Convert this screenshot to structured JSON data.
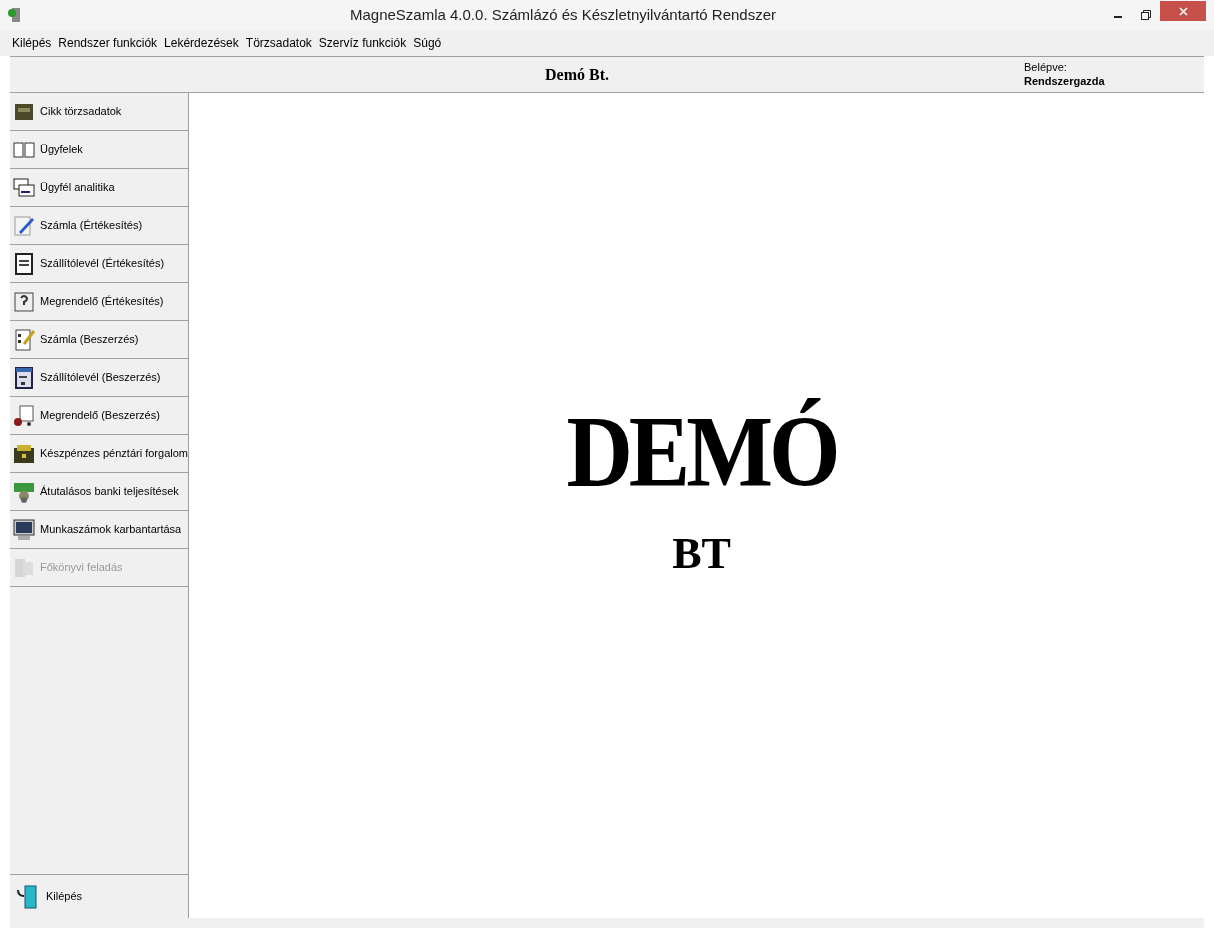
{
  "window": {
    "title": "MagneSzamla 4.0.0. Számlázó és Készletnyilvántartó Rendszer"
  },
  "menu": [
    "Kilépés",
    "Rendszer funkciók",
    "Lekérdezések",
    "Törzsadatok",
    "Szervíz funkciók",
    "Súgó"
  ],
  "header": {
    "company": "Demó Bt.",
    "login_label": "Belépve:",
    "user": "Rendszergazda"
  },
  "sidebar": {
    "items": [
      {
        "label": "Cikk törzsadatok",
        "disabled": false
      },
      {
        "label": "Ügyfelek",
        "disabled": false
      },
      {
        "label": "Ügyfél analitika",
        "disabled": false
      },
      {
        "label": "Számla (Értékesítés)",
        "disabled": false
      },
      {
        "label": "Szállítólevél (Értékesítés)",
        "disabled": false
      },
      {
        "label": "Megrendelő (Értékesítés)",
        "disabled": false
      },
      {
        "label": "Számla (Beszerzés)",
        "disabled": false
      },
      {
        "label": "Szállítólevél (Beszerzés)",
        "disabled": false
      },
      {
        "label": "Megrendelő (Beszerzés)",
        "disabled": false
      },
      {
        "label": "Készpénzes pénztári forgalom",
        "disabled": false
      },
      {
        "label": "Átutalásos banki teljesítések",
        "disabled": false
      },
      {
        "label": "Munkaszámok karbantartása",
        "disabled": false
      },
      {
        "label": "Főkönyvi feladás",
        "disabled": true
      }
    ],
    "exit": "Kilépés"
  },
  "logo": {
    "title": "DEMÓ",
    "subtitle": "BT"
  }
}
